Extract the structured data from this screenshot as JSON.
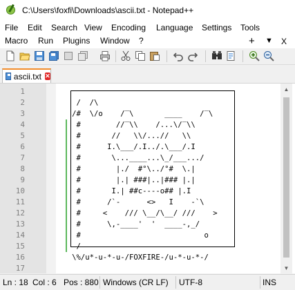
{
  "window": {
    "title": "C:\\Users\\foxfi\\Downloads\\ascii.txt - Notepad++"
  },
  "menu": {
    "row1": [
      "File",
      "Edit",
      "Search",
      "View",
      "Encoding",
      "Language",
      "Settings",
      "Tools"
    ],
    "row2": [
      "Macro",
      "Run",
      "Plugins",
      "Window",
      "?"
    ],
    "right": {
      "add": "+",
      "dropdown": "▼",
      "close": "X"
    }
  },
  "toolbar": {
    "icons": [
      "new-file-icon",
      "open-file-icon",
      "save-icon",
      "save-all-icon",
      "close-icon",
      "close-all-icon",
      "print-icon",
      "cut-icon",
      "copy-icon",
      "paste-icon",
      "undo-icon",
      "redo-icon",
      "find-icon",
      "replace-icon",
      "zoom-in-icon",
      "zoom-out-icon"
    ]
  },
  "tab": {
    "label": "ascii.txt"
  },
  "editor": {
    "line_numbers": [
      "1",
      "2",
      "3",
      "4",
      "5",
      "6",
      "7",
      "8",
      "9",
      "10",
      "11",
      "12",
      "13",
      "14",
      "15",
      "16",
      "17"
    ],
    "lines": [
      "",
      "    /  /\\",
      "   /#  \\/o    /‾\\       ____    /‾\\",
      "    #        //‾\\\\    /...\\/‾\\\\",
      "    #       //   \\\\/...//   \\\\",
      "    #      I.\\___/.I../.\\___/.I",
      "    #       \\...____...\\_/___.../",
      "    #        |./  #°\\../°#  \\.|",
      "    #        |.| ###|..|### |.|",
      "    #       I.| ##c----o## |.I",
      "    #      /`-      <>   I    -`\\",
      "    #     <    /// \\__/\\__/ ///    >",
      "    #      \\,-____'  '  ____-,_/",
      "    #                            o",
      "    /",
      "   \\%/u*-u-*-u-/FOXFIRE-/u-*-u-*-/",
      ""
    ]
  },
  "status": {
    "ln": "Ln : 18",
    "col": "Col : 6",
    "pos": "Pos : 880",
    "eol": "Windows (CR LF)",
    "encoding": "UTF-8",
    "mode": "INS"
  }
}
